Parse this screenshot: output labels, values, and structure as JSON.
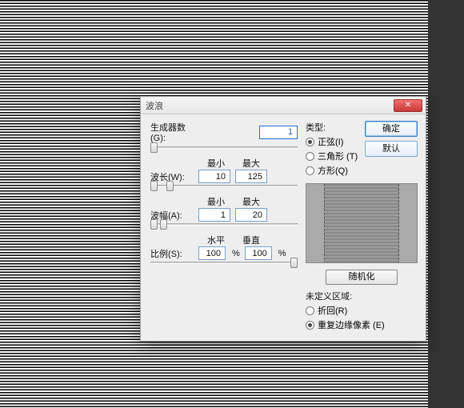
{
  "dialog": {
    "title": "波浪",
    "close_label": "✕"
  },
  "left": {
    "generators": {
      "label": "生成器数(G):",
      "value": "1"
    },
    "wavelength": {
      "label": "波长(W):",
      "min_header": "最小",
      "max_header": "最大",
      "min": "10",
      "max": "125"
    },
    "amplitude": {
      "label": "波幅(A):",
      "min_header": "最小",
      "max_header": "最大",
      "min": "1",
      "max": "20"
    },
    "scale": {
      "label": "比例(S):",
      "h_header": "水平",
      "v_header": "垂直",
      "horizontal": "100",
      "vertical": "100",
      "unit": "%"
    }
  },
  "right": {
    "type_group": "类型:",
    "type_options": {
      "sine": "正弦(I)",
      "triangle": "三角形 (T)",
      "square": "方形(Q)"
    },
    "ok": "确定",
    "default": "默认",
    "randomize": "随机化",
    "undefined_group": "未定义区域:",
    "undefined_options": {
      "wrap": "折回(R)",
      "repeat": "重复边缘像素 (E)"
    }
  }
}
